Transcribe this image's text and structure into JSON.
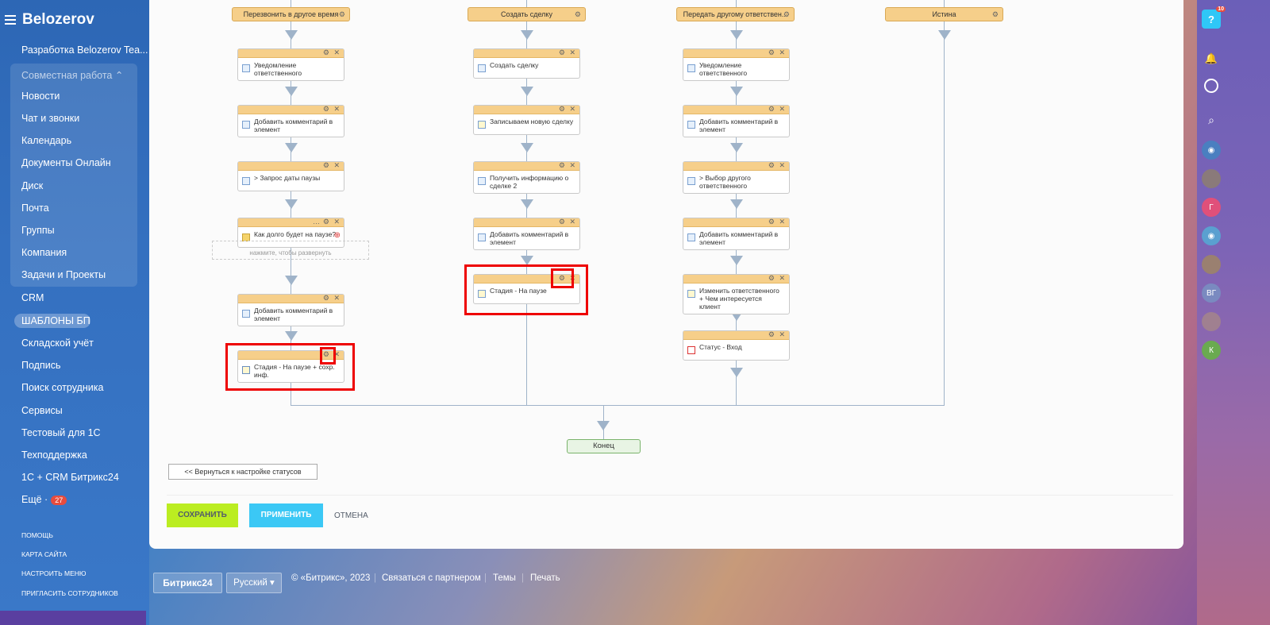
{
  "sidebar": {
    "logo": "Belozerov",
    "items": [
      {
        "label": "Разработка Belozerov Tea...",
        "top": 0
      },
      {
        "label": "Новости"
      },
      {
        "label": "Чат и звонки"
      },
      {
        "label": "Календарь"
      },
      {
        "label": "Документы Онлайн"
      },
      {
        "label": "Диск"
      },
      {
        "label": "Почта"
      },
      {
        "label": "Группы"
      },
      {
        "label": "Компания"
      },
      {
        "label": "Задачи и Проекты"
      },
      {
        "label": "CRM"
      },
      {
        "label": "ШАБЛОНЫ БП"
      },
      {
        "label": "Складской учёт"
      },
      {
        "label": "Подпись"
      },
      {
        "label": "Поиск сотрудника"
      },
      {
        "label": "Сервисы"
      },
      {
        "label": "Тестовый для 1С"
      },
      {
        "label": "Техподдержка"
      },
      {
        "label": "1С + CRM Битрикс24"
      }
    ],
    "group_title": "Совместная работа",
    "more_label": "Ещё ·",
    "more_count": "27",
    "small_links": [
      "ПОМОЩЬ",
      "КАРТА САЙТА",
      "НАСТРОИТЬ МЕНЮ",
      "ПРИГЛАСИТЬ СОТРУДНИКОВ"
    ]
  },
  "diagram": {
    "branch_titles": [
      "Перезвонить в другое время",
      "Создать сделку",
      "Передать другому ответствен...",
      "Истина"
    ],
    "col1": [
      "Уведомление ответственного",
      "Добавить комментарий в элемент",
      "> Запрос даты паузы",
      "Как долго будет на паузе?",
      "Добавить комментарий в элемент",
      "Стадия - На паузе + сохр. инф."
    ],
    "col2": [
      "Создать сделку",
      "Записываем новую сделку",
      "Получить информацию о сделке 2",
      "Добавить комментарий в элемент",
      "Стадия - На паузе"
    ],
    "col3": [
      "Уведомление ответственного",
      "Добавить комментарий в элемент",
      "> Выбор другого ответственного",
      "Добавить комментарий в элемент",
      "Изменить ответственного + Чем интересуется клиент",
      "Статус - Вход"
    ],
    "expand_hint": "нажмите, чтобы развернуть",
    "end_label": "Конец"
  },
  "actions": {
    "back": "<< Вернуться к настройке статусов",
    "save": "СОХРАНИТЬ",
    "apply": "ПРИМЕНИТЬ",
    "cancel": "ОТМЕНА"
  },
  "footer": {
    "logo": "Битрикс24",
    "language": "Русский",
    "copyright": "© «Битрикс», 2023",
    "partner": "Связаться с партнером",
    "themes": "Темы",
    "print": "Печать"
  },
  "rightbar": {
    "help_count": "10",
    "avatars": [
      "Г",
      "ВГ",
      "К"
    ]
  }
}
